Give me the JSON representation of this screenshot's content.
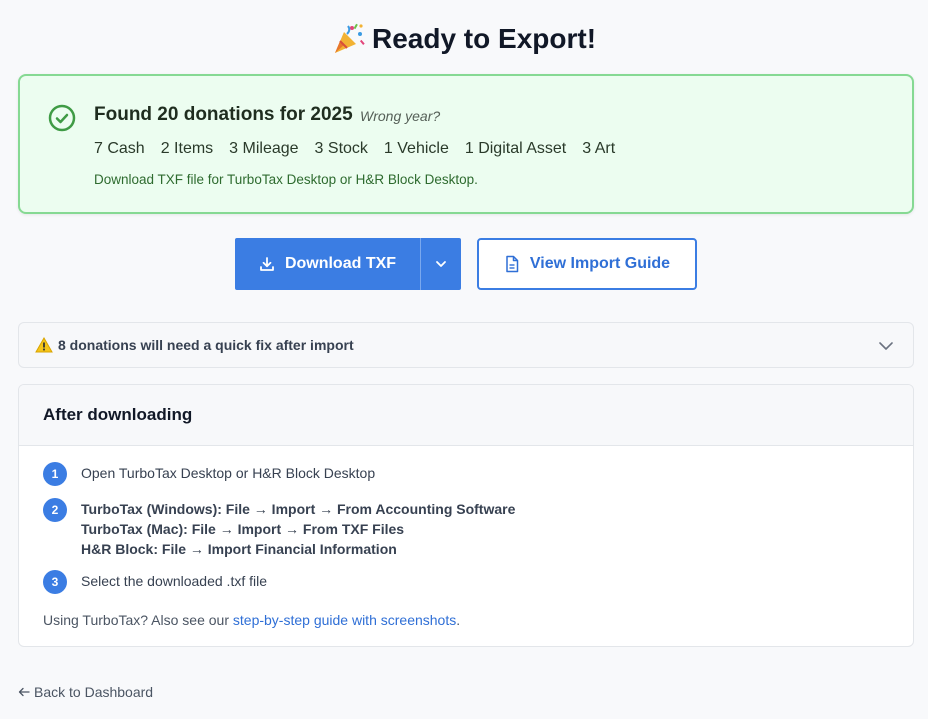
{
  "header": {
    "title": "Ready to Export!"
  },
  "summary": {
    "found": "Found 20 donations for 2025",
    "wrong_year": "Wrong year?",
    "counts": [
      "7 Cash",
      "2 Items",
      "3 Mileage",
      "3 Stock",
      "1 Vehicle",
      "1 Digital Asset",
      "3 Art"
    ],
    "description": "Download TXF file for TurboTax Desktop or H&R Block Desktop."
  },
  "actions": {
    "download_label": "Download TXF",
    "guide_label": "View Import Guide"
  },
  "warning": {
    "text": "8 donations will need a quick fix after import"
  },
  "after": {
    "title": "After downloading",
    "step1_num": "1",
    "step1": "Open TurboTax Desktop or H&R Block Desktop",
    "step2_num": "2",
    "step2_lines": [
      "TurboTax (Windows): File → Import → From Accounting Software",
      "TurboTax (Mac): File → Import → From TXF Files",
      "H&R Block: File → Import Financial Information"
    ],
    "step3_num": "3",
    "step3": "Select the downloaded .txf file",
    "note_prefix": "Using TurboTax? Also see our ",
    "note_link": "step-by-step guide with screenshots",
    "note_suffix": "."
  },
  "nav": {
    "back": "Back to Dashboard"
  },
  "colors": {
    "accent": "#3b7de3",
    "success_bg": "#ecfdf0",
    "success_border": "#86d993"
  }
}
